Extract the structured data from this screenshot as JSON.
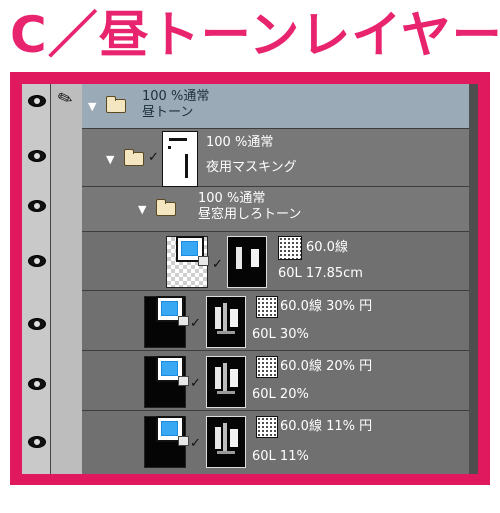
{
  "title": "C／昼トーンレイヤー",
  "colors": {
    "accent": "#e8246e",
    "panel": "#6f6f6f",
    "selected": "#9aaab6"
  },
  "layers": [
    {
      "opacity": "100 %",
      "mode": "通常",
      "name": "昼トーン",
      "type": "folder",
      "selected": true
    },
    {
      "opacity": "100 %",
      "mode": "通常",
      "name": "夜用マスキング",
      "type": "folder-mask"
    },
    {
      "opacity": "100 %",
      "mode": "通常",
      "name": "昼窓用しろトーン",
      "type": "folder"
    },
    {
      "screen": "60.0線",
      "detail": "60L 17.85cm",
      "type": "tone"
    },
    {
      "screen": "60.0線 30% 円",
      "detail": "60L 30%",
      "type": "tone"
    },
    {
      "screen": "60.0線 20% 円",
      "detail": "60L 20%",
      "type": "tone"
    },
    {
      "screen": "60.0線 11% 円",
      "detail": "60L 11%",
      "type": "tone"
    }
  ],
  "icons": {
    "visibility": "eye-icon",
    "edit": "pen-icon",
    "folder": "folder-icon",
    "expand": "triangle-down-icon"
  }
}
